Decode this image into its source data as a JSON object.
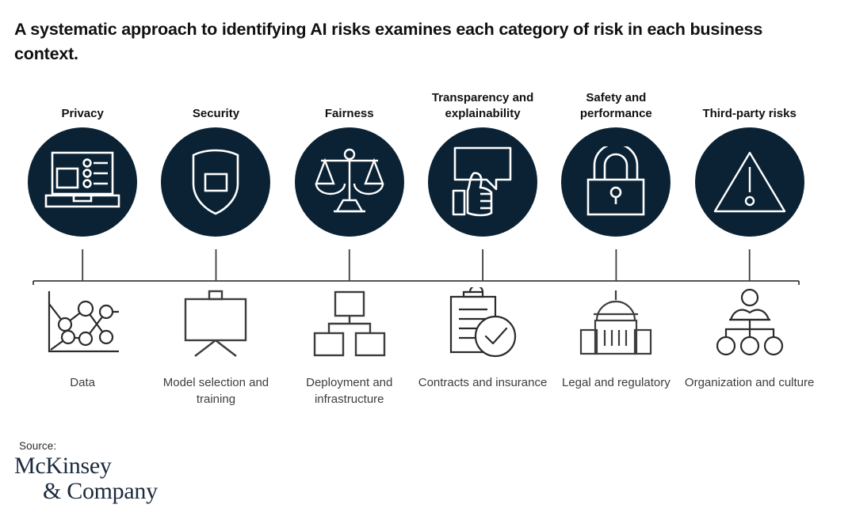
{
  "title": "A systematic approach to identifying AI risks examines each category of risk in each business context.",
  "theme": {
    "circle_fill": "#0b2234",
    "icon_stroke": "#ffffff",
    "line_color": "#3d3d3d",
    "title_color": "#111111",
    "label_color": "#3d3d3d",
    "logo_color": "#1b2a3d",
    "background": "#ffffff"
  },
  "risk_categories": [
    {
      "label": "Privacy",
      "icon": "laptop-list-icon"
    },
    {
      "label": "Security",
      "icon": "shield-icon"
    },
    {
      "label": "Fairness",
      "icon": "balance-scales-icon"
    },
    {
      "label": "Transparency and explainability",
      "icon": "thumbs-up-speech-bubble-icon"
    },
    {
      "label": "Safety and performance",
      "icon": "padlock-icon"
    },
    {
      "label": "Third-party risks",
      "icon": "warning-triangle-icon"
    }
  ],
  "business_contexts": [
    {
      "label": "Data",
      "icon": "line-chart-icon"
    },
    {
      "label": "Model selection and training",
      "icon": "presentation-board-icon"
    },
    {
      "label": "Deployment and infrastructure",
      "icon": "hierarchy-boxes-icon"
    },
    {
      "label": "Contracts and insurance",
      "icon": "clipboard-check-icon"
    },
    {
      "label": "Legal and regulatory",
      "icon": "government-building-icon"
    },
    {
      "label": "Organization and culture",
      "icon": "person-org-chart-icon"
    }
  ],
  "footer": {
    "source_label": "Source:",
    "logo_line1": "McKinsey",
    "logo_line2": "& Company"
  }
}
